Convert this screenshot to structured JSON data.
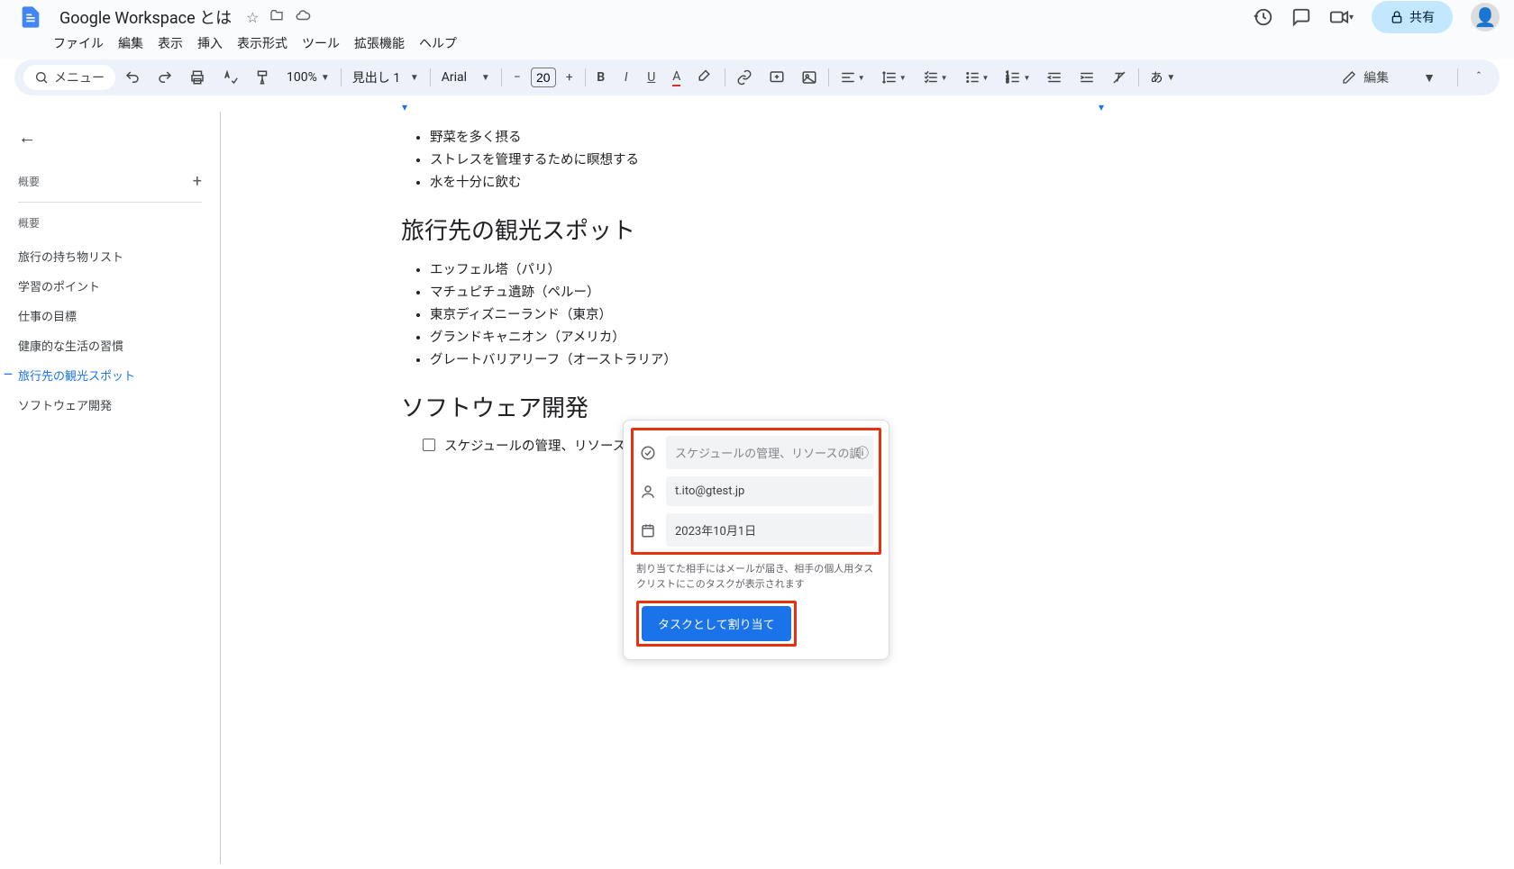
{
  "header": {
    "doc_title": "Google Workspace とは",
    "share_label": "共有",
    "menus": [
      "ファイル",
      "編集",
      "表示",
      "挿入",
      "表示形式",
      "ツール",
      "拡張機能",
      "ヘルプ"
    ]
  },
  "toolbar": {
    "menu_label": "メニュー",
    "zoom": "100%",
    "style": "見出し 1",
    "font": "Arial",
    "font_size": "20",
    "edit_mode": "編集",
    "ime": "あ"
  },
  "outline": {
    "summary_label": "概要",
    "section_label": "概要",
    "items": [
      {
        "label": "旅行の持ち物リスト",
        "active": false
      },
      {
        "label": "学習のポイント",
        "active": false
      },
      {
        "label": "仕事の目標",
        "active": false
      },
      {
        "label": "健康的な生活の習慣",
        "active": false
      },
      {
        "label": "旅行先の観光スポット",
        "active": true
      },
      {
        "label": "ソフトウェア開発",
        "active": false
      }
    ]
  },
  "document": {
    "health_items": [
      "野菜を多く摂る",
      "ストレスを管理するために瞑想する",
      "水を十分に飲む"
    ],
    "heading_travel": "旅行先の観光スポット",
    "travel_items": [
      "エッフェル塔（パリ）",
      "マチュピチュ遺跡（ペルー）",
      "東京ディズニーランド（東京）",
      "グランドキャニオン（アメリカ）",
      "グレートバリアリーフ（オーストラリア）"
    ],
    "heading_software": "ソフトウェア開発",
    "checkbox_item": "スケジュールの管理、リソースの調整"
  },
  "task_popup": {
    "title_placeholder": "スケジュールの管理、リソースの調",
    "assignee": "t.ito@gtest.jp",
    "date": "2023年10月1日",
    "note": "割り当てた相手にはメールが届き、相手の個人用タスクリストにこのタスクが表示されます",
    "assign_button": "タスクとして割り当て"
  }
}
